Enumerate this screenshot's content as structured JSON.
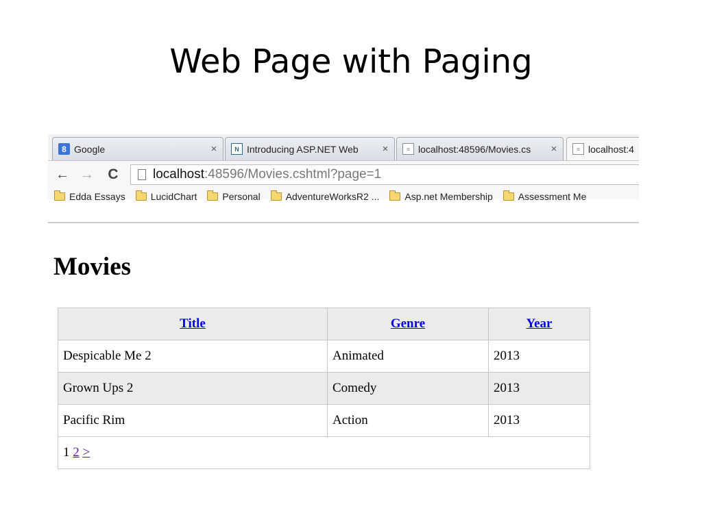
{
  "slide": {
    "title": "Web Page with Paging"
  },
  "browser": {
    "tabs": [
      {
        "label": "Google",
        "favicon": "google-icon"
      },
      {
        "label": "Introducing ASP.NET Web",
        "favicon": "aspnet-icon"
      },
      {
        "label": "localhost:48596/Movies.cs",
        "favicon": "page-icon"
      },
      {
        "label": "localhost:4",
        "favicon": "page-icon",
        "active": true
      }
    ],
    "tab_close_glyph": "×",
    "nav": {
      "back": "←",
      "forward": "→",
      "reload": "C"
    },
    "address": {
      "host": "localhost",
      "rest": ":48596/Movies.cshtml?page=1"
    },
    "bookmarks": [
      "Edda Essays",
      "LucidChart",
      "Personal",
      "AdventureWorksR2 ...",
      "Asp.net Membership",
      "Assessment Me"
    ]
  },
  "page": {
    "heading": "Movies",
    "table": {
      "headers": [
        "Title",
        "Genre",
        "Year"
      ],
      "rows": [
        [
          "Despicable Me 2",
          "Animated",
          "2013"
        ],
        [
          "Grown Ups 2",
          "Comedy",
          "2013"
        ],
        [
          "Pacific Rim",
          "Action",
          "2013"
        ]
      ]
    },
    "pager": {
      "current": "1",
      "next_page": "2",
      "next_arrow": ">"
    }
  }
}
